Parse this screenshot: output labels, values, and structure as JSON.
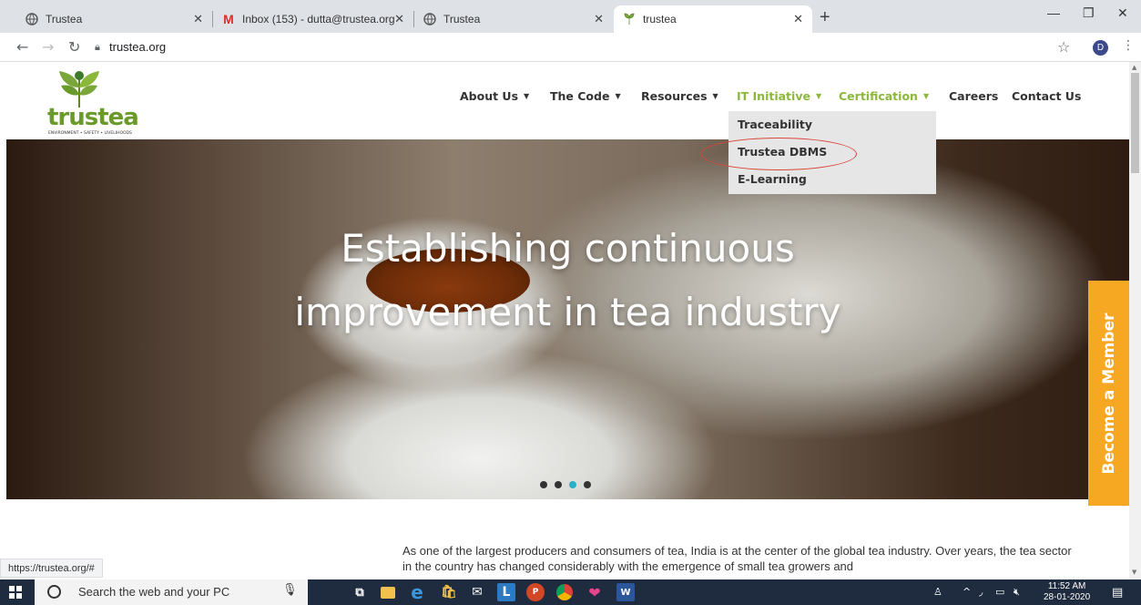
{
  "browser": {
    "tabs": [
      {
        "title": "Trustea",
        "favicon": "globe-icon"
      },
      {
        "title": "Inbox (153) - dutta@trustea.org",
        "favicon": "gmail-icon"
      },
      {
        "title": "Trustea",
        "favicon": "globe-icon"
      },
      {
        "title": "trustea",
        "favicon": "trustea-leaf-icon",
        "active": true
      }
    ],
    "address": "trustea.org",
    "profile_initial": "D",
    "status_url": "https://trustea.org/#"
  },
  "site": {
    "logo_text": "trustea",
    "logo_tagline": "ENVIRONMENT • SAFETY • LIVELIHOODS",
    "nav": [
      {
        "label": "About Us",
        "dropdown": true
      },
      {
        "label": "The Code",
        "dropdown": true
      },
      {
        "label": "Resources",
        "dropdown": true
      },
      {
        "label": "IT Initiative",
        "dropdown": true,
        "active": true
      },
      {
        "label": "Certification",
        "dropdown": true,
        "active": true
      },
      {
        "label": "Careers",
        "dropdown": false
      },
      {
        "label": "Contact Us",
        "dropdown": false
      }
    ],
    "dropdown_items": [
      "Traceability",
      "Trustea DBMS",
      "E-Learning"
    ],
    "hero": {
      "line1": "Establishing continuous",
      "line2": "improvement in tea industry",
      "slides": 4,
      "active_slide": 3
    },
    "member_button": "Become a Member",
    "intro_text": "As one of the largest producers and consumers of tea, India is at the center of the global tea industry. Over years, the tea sector in the country has changed considerably with the emergence of small tea growers and"
  },
  "taskbar": {
    "search_placeholder": "Search the web and your PC",
    "time": "11:52 AM",
    "date": "28-01-2020"
  },
  "colors": {
    "accent_green": "#8bb83a",
    "member_orange": "#f7a823",
    "highlight_red": "#d9453a",
    "slider_dot_active": "#2ab0c8"
  }
}
